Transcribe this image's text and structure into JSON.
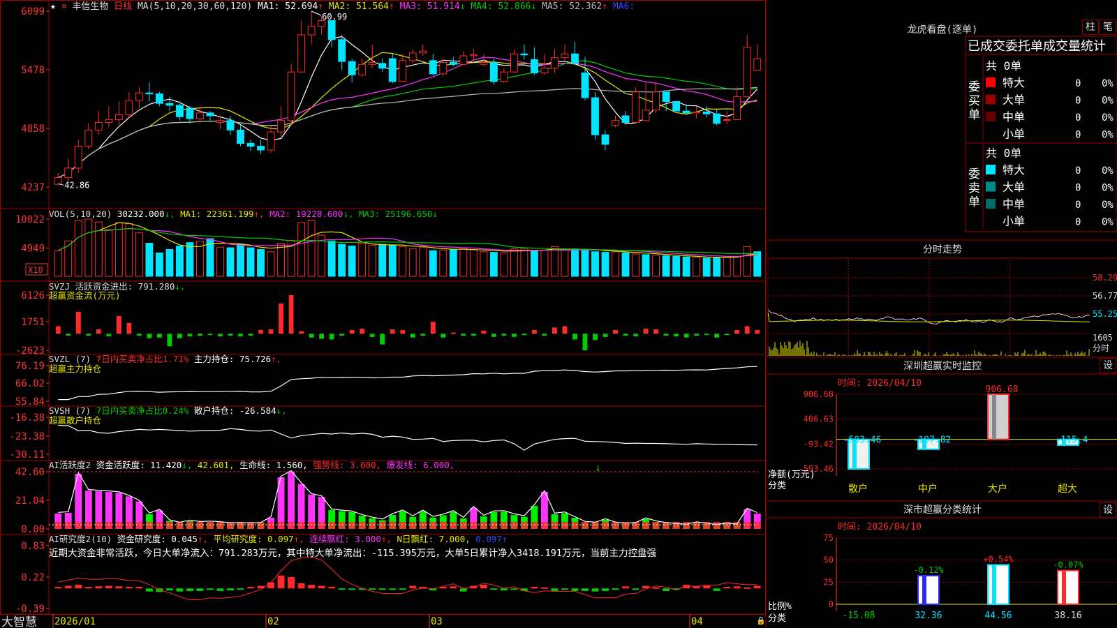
{
  "colors": {
    "up": "#ff2a2a",
    "down": "#00e4ff",
    "grid": "#a00000",
    "white": "#ffffff",
    "yellow": "#e6e600",
    "magenta": "#ff33ff",
    "green": "#00cc00",
    "gray": "#bbbbbb",
    "text": "#c8c8c8",
    "axis": "#ff3333"
  },
  "header": {
    "stock_name": "丰信生物",
    "period": "日线",
    "ma_title": "MA(5,10,20,30,60,120)",
    "ma_values": [
      {
        "label": "MA1: 52.694",
        "arrow": "↑",
        "color": "#ffffff"
      },
      {
        "label": "MA2: 51.564",
        "arrow": "↑",
        "color": "#e6e600"
      },
      {
        "label": "MA3: 51.914",
        "arrow": "↓",
        "color": "#ff33ff"
      },
      {
        "label": "MA4: 52.866",
        "arrow": "↓",
        "color": "#00cc00"
      },
      {
        "label": "MA5: 52.362",
        "arrow": "↑",
        "color": "#bbbbbb"
      },
      {
        "label": "MA6:",
        "arrow": "",
        "color": "#2a4dff"
      }
    ],
    "high_label": "60.99",
    "low_label": "42.86"
  },
  "price_axis": {
    "ticks": [
      "6099",
      "5478",
      "4858",
      "4237"
    ]
  },
  "volume": {
    "title": "VOL(5,10,20)",
    "value": "30232.000",
    "value_arrow": "↓",
    "ma1": "MA1: 22361.199",
    "ma1_arrow": "↑",
    "ma2": "MA2: 19228.600",
    "ma2_arrow": "↓",
    "ma3": "MA3: 25196.650",
    "ma3_arrow": "↓",
    "ticks": [
      "10022",
      "4949"
    ],
    "unit": "X10"
  },
  "svzj": {
    "title": "SVZJ  活跃资金进出: 791.280",
    "arrow": "↓",
    "subtitle": "超赢资金流(万元)",
    "ticks": [
      "6126",
      "1751",
      "-2623"
    ]
  },
  "svzl": {
    "title": "SVZL (7)",
    "red_text": "7日内买卖净占比1.71%",
    "white_text": "主力持仓: 75.726",
    "arrow": "↑",
    "subtitle": "超赢主力持仓",
    "ticks": [
      "76.19",
      "66.02",
      "55.84"
    ]
  },
  "svsh": {
    "title": "SVSH (7)",
    "green_text": "7日内买卖净占比0.24%",
    "white_text": "散户持仓: -26.584",
    "arrow": "↓",
    "subtitle": "超赢散户持仓",
    "ticks": [
      "-16.38",
      "-23.38",
      "-30.11"
    ]
  },
  "ai_active": {
    "title": "AI活跃度2",
    "l1": "资金活跃度: 11.420",
    "l1_arrow": "↓",
    "l2": "42.601",
    "l3": "生命线: 1.560",
    "l4": "强势线: 3.000",
    "l5": "爆发线: 6.000",
    "ticks": [
      "42.60",
      "21.04",
      "0.00"
    ]
  },
  "ai_research": {
    "title": "AI研究度2(10)",
    "l1": "资金研究度: 0.045",
    "l1_arrow": "↑",
    "l2": "平均研究度: 0.097",
    "l2_arrow": "↑",
    "l3": "连续飘红: 3.000",
    "l3_arrow": "↑",
    "l4": "N日飘红: 7.000",
    "l5": "0.097",
    "l5_arrow": "↑",
    "summary": "近期大资金非常活跃，今日大单净流入：791.283万元，其中特大单净流出：-115.395万元，大单5日累计净入3418.191万元，当前主力控盘强",
    "ticks": [
      "0.83",
      "0.22",
      "-0.39"
    ]
  },
  "date_axis": {
    "labels": [
      "2026/01",
      "02",
      "03",
      "04"
    ],
    "brand": "大智慧"
  },
  "dragon_tiger": {
    "title": "龙虎看盘(逐单)",
    "btn1": "柱",
    "btn2": "笔",
    "header": "已成交委托单成交量统计",
    "buy": {
      "side_label": "委买单",
      "total": "共 0单",
      "rows": [
        {
          "name": "特大",
          "count": "0",
          "pct": "0%",
          "color": "#ff0000"
        },
        {
          "name": "大单",
          "count": "0",
          "pct": "0%",
          "color": "#990000"
        },
        {
          "name": "中单",
          "count": "0",
          "pct": "0%",
          "color": "#660000"
        },
        {
          "name": "小单",
          "count": "0",
          "pct": "0%",
          "color": ""
        }
      ]
    },
    "sell": {
      "side_label": "委卖单",
      "total": "共 0单",
      "rows": [
        {
          "name": "特大",
          "count": "0",
          "pct": "0%",
          "color": "#00e4ff"
        },
        {
          "name": "大单",
          "count": "0",
          "pct": "0%",
          "color": "#008b8b"
        },
        {
          "name": "中单",
          "count": "0",
          "pct": "0%",
          "color": "#006b6b"
        },
        {
          "name": "小单",
          "count": "0",
          "pct": "0%",
          "color": ""
        }
      ]
    }
  },
  "intraday": {
    "title": "分时走势",
    "ticks": [
      "58.29",
      "56.77",
      "55.25",
      "1605"
    ],
    "unit": "分时"
  },
  "sz_monitor": {
    "title": "深圳超赢实时监控",
    "btn": "设",
    "time": "时间: 2026/04/10",
    "ylabel": "净额(万元)",
    "xlabel": "分类"
  },
  "sz_class": {
    "title": "深市超赢分类统计",
    "btn": "设",
    "time": "时间: 2026/04/10",
    "ylabel": "比例%",
    "xlabel": "分类"
  },
  "chart_data": [
    {
      "type": "candlestick",
      "name": "price",
      "open": [
        42.8,
        43.5,
        44.5,
        46.8,
        48.5,
        49.3,
        49.6,
        50.1,
        51.6,
        52.4,
        52.3,
        51.3,
        51.1,
        50.8,
        49.7,
        50.3,
        49.3,
        49.5,
        48.5,
        47.1,
        46.8,
        46.4,
        48.3,
        49.5,
        54.6,
        58.5,
        59.4,
        60,
        58,
        55.7,
        54.3,
        55.4,
        55.5,
        56,
        53.6,
        55.8,
        56.6,
        55.8,
        54.4,
        55.6,
        55.4,
        56.3,
        55.4,
        55.6,
        53.6,
        54.6,
        56.5,
        55.9,
        54.5,
        55,
        56.1,
        56.5,
        54.5,
        51.9,
        48,
        49,
        50,
        49.3,
        49.5,
        50.6,
        52.5,
        51.5,
        50.5,
        50.3,
        50.4,
        50.2,
        49.6,
        49.6,
        52,
        54.8
      ],
      "close": [
        43.5,
        44.5,
        46.8,
        48.5,
        49.3,
        49.6,
        50.1,
        51.6,
        52.4,
        52.3,
        51.3,
        51.1,
        49.9,
        49.7,
        50.3,
        50,
        49.5,
        48.5,
        47.1,
        46.8,
        46.4,
        48.3,
        49.5,
        54.6,
        58.5,
        59.4,
        60,
        58,
        55.7,
        54.3,
        55.4,
        55.6,
        55,
        53.6,
        55.8,
        56.6,
        56.8,
        54.4,
        55.6,
        55.4,
        56.3,
        56.4,
        55.6,
        53.6,
        54.6,
        56.5,
        56.4,
        54.5,
        55,
        56.1,
        56.5,
        55.5,
        51.9,
        48,
        47,
        49.5,
        49.3,
        52.5,
        50.6,
        52.5,
        51.5,
        50.5,
        50.3,
        50.4,
        50.2,
        49.2,
        49.6,
        52,
        57.2,
        56
      ],
      "high": [
        44,
        45.5,
        47.5,
        49.2,
        50.5,
        51,
        51.5,
        52.5,
        53,
        53.5,
        52.5,
        52,
        51.5,
        51,
        51,
        50.5,
        50,
        50,
        49,
        47.5,
        47.5,
        49,
        51,
        55.5,
        60,
        60.99,
        60.5,
        60,
        58.5,
        56,
        56,
        57.5,
        56,
        56.5,
        56.5,
        57,
        57.5,
        56.5,
        56,
        56.2,
        56.8,
        57,
        56.5,
        56,
        55,
        57,
        57.5,
        57.2,
        56.5,
        57,
        57.5,
        57.8,
        56.2,
        52.5,
        48.5,
        50,
        50.5,
        53,
        53.5,
        53.5,
        52,
        51,
        51.2,
        51,
        51,
        50.7,
        50.5,
        53,
        58.5,
        57.5
      ],
      "low": [
        42.86,
        43,
        44,
        46.5,
        48,
        48.8,
        49,
        49.8,
        50.8,
        51.5,
        51,
        50.5,
        49.5,
        49.2,
        49.2,
        49.5,
        48.6,
        48,
        46.8,
        46.3,
        46,
        46.1,
        47.8,
        49,
        54.5,
        57.5,
        58.5,
        57.2,
        54.8,
        53.5,
        54,
        55,
        54.6,
        53.4,
        53.6,
        55.5,
        56.3,
        54.2,
        54.2,
        55.2,
        55.3,
        55.8,
        55.2,
        53.3,
        53.5,
        54.5,
        55.9,
        54.3,
        54.3,
        54.5,
        55.8,
        55.4,
        51.6,
        47.5,
        46.4,
        48.8,
        49.2,
        49.3,
        50.5,
        50.3,
        50.5,
        50.5,
        50.2,
        49.7,
        49.8,
        49,
        49.1,
        51.8,
        52,
        55.5
      ],
      "ylim": [
        42.37,
        60.99
      ]
    },
    {
      "type": "bar",
      "name": "volume",
      "values": [
        4500,
        6200,
        9800,
        10022,
        9500,
        8200,
        9400,
        9200,
        7600,
        5800,
        4100,
        4700,
        5300,
        5900,
        6100,
        6600,
        5100,
        5000,
        5600,
        5000,
        4700,
        4300,
        5800,
        6300,
        9400,
        9800,
        7200,
        6200,
        5600,
        5300,
        5800,
        5400,
        5600,
        5400,
        5200,
        4800,
        5100,
        4500,
        4600,
        4700,
        4800,
        4700,
        4300,
        4200,
        4100,
        4800,
        4900,
        4500,
        4600,
        5200,
        4600,
        4800,
        4500,
        4300,
        4200,
        4300,
        4100,
        3900,
        3800,
        3700,
        3600,
        3500,
        3400,
        3300,
        3200,
        3300,
        3400,
        3500,
        5200,
        4300
      ],
      "up_down": [
        1,
        1,
        1,
        1,
        1,
        1,
        1,
        1,
        1,
        0,
        0,
        0,
        0,
        0,
        1,
        0,
        1,
        0,
        0,
        0,
        0,
        1,
        1,
        1,
        1,
        1,
        1,
        0,
        0,
        0,
        1,
        1,
        0,
        0,
        1,
        1,
        1,
        0,
        1,
        0,
        1,
        1,
        1,
        0,
        1,
        1,
        1,
        0,
        1,
        1,
        1,
        0,
        0,
        0,
        0,
        1,
        0,
        1,
        0,
        1,
        0,
        0,
        0,
        1,
        0,
        0,
        1,
        1,
        1,
        0
      ],
      "ylim": [
        0,
        10500
      ]
    },
    {
      "type": "bar",
      "name": "svzj",
      "values": [
        1200,
        -300,
        3500,
        -300,
        700,
        -400,
        2800,
        1700,
        -300,
        -700,
        -600,
        -2000,
        -700,
        -400,
        -300,
        -200,
        -400,
        -300,
        -400,
        -300,
        600,
        700,
        4800,
        6126,
        400,
        -600,
        -800,
        -900,
        -300,
        600,
        800,
        -500,
        -1700,
        700,
        600,
        -600,
        -300,
        1900,
        -600,
        200,
        -300,
        -300,
        500,
        -500,
        -300,
        -500,
        -200,
        600,
        -300,
        1000,
        1200,
        -900,
        -2623,
        -1000,
        -500,
        600,
        -300,
        -400,
        800,
        700,
        -300,
        -400,
        -600,
        -300,
        -200,
        -600,
        -200,
        600,
        1200,
        600
      ],
      "ylim": [
        -2623,
        6126
      ]
    },
    {
      "type": "line",
      "name": "svzl",
      "values": [
        56.8,
        56.8,
        58.5,
        58.5,
        59.8,
        59.9,
        60.8,
        61.5,
        61.6,
        61.3,
        61,
        61.2,
        61.3,
        61.4,
        61.3,
        61.3,
        61.3,
        61.5,
        61.6,
        61.2,
        61.2,
        61.5,
        64.6,
        68.3,
        68.7,
        69,
        69.5,
        69.3,
        69.4,
        69.5,
        69.5,
        69.2,
        69.3,
        69.6,
        69.6,
        70.3,
        70.6,
        70.4,
        70.6,
        70.8,
        71,
        71.6,
        71.5,
        71.9,
        71.5,
        71.8,
        71.8,
        73,
        73.3,
        73.4,
        73.7,
        73.4,
        72.8,
        72.5,
        72.8,
        73.2,
        73.2,
        73.3,
        73.5,
        73.5,
        73.6,
        73.5,
        73.7,
        73.8,
        73.7,
        74.2,
        74.6,
        74.9,
        75.5,
        75.7
      ],
      "ylim": [
        55.84,
        76.19
      ]
    },
    {
      "type": "line",
      "name": "svsh",
      "values": [
        -19.4,
        -19.5,
        -21.4,
        -21.2,
        -22.1,
        -22.3,
        -21.7,
        -21.3,
        -20.9,
        -21.1,
        -20.9,
        -21.1,
        -21.3,
        -21.5,
        -21.4,
        -21.3,
        -21.2,
        -20.6,
        -20.9,
        -21.4,
        -21.5,
        -21.1,
        -22.6,
        -24.1,
        -23.2,
        -22.8,
        -22.4,
        -22.6,
        -22.2,
        -22.6,
        -22.3,
        -22.7,
        -23.8,
        -23.4,
        -23.7,
        -24.6,
        -24.5,
        -24.2,
        -25.4,
        -25,
        -24.9,
        -24.9,
        -25.5,
        -25,
        -24.8,
        -26.2,
        -28.6,
        -26.3,
        -25.4,
        -24.6,
        -24.3,
        -24.2,
        -25.3,
        -25.4,
        -25.5,
        -25.7,
        -26.1,
        -26,
        -26.1,
        -26.1,
        -26.2,
        -26.3,
        -26.4,
        -26.2,
        -26.3,
        -26.4,
        -26.4,
        -26.5,
        -26.6,
        -26.6
      ],
      "ylim": [
        -30.11,
        -16.38
      ]
    },
    {
      "type": "bar",
      "name": "ai_active",
      "values": [
        11.5,
        12,
        41,
        28.5,
        28,
        27.5,
        26.8,
        24.2,
        20.5,
        11,
        13.8,
        6,
        4.2,
        5.8,
        4.7,
        5,
        4.6,
        3.7,
        3.8,
        3.6,
        4,
        8.3,
        38.5,
        42.6,
        33.5,
        25.5,
        23.8,
        14,
        13.2,
        12.5,
        9.8,
        8,
        6.5,
        10.5,
        13.3,
        9,
        13.2,
        8.5,
        10.2,
        12.8,
        7.8,
        15.8,
        9.3,
        12.6,
        12.8,
        10.5,
        9,
        17.2,
        27.6,
        11,
        11.8,
        8.3,
        4.8,
        4.2,
        6.8,
        4.3,
        3.5,
        3.9,
        7.4,
        5.2,
        3.9,
        3.3,
        2.7,
        4.4,
        3.5,
        2.5,
        3.6,
        2.8,
        14.6,
        11.4
      ],
      "magenta": [
        1,
        1,
        1,
        1,
        1,
        1,
        1,
        1,
        1,
        0,
        1,
        0,
        0,
        0,
        0,
        0,
        0,
        0,
        0,
        0,
        0,
        1,
        1,
        1,
        1,
        1,
        1,
        0,
        0,
        0,
        0,
        0,
        0,
        0,
        0,
        0,
        0,
        0,
        0,
        0,
        0,
        1,
        0,
        0,
        0,
        0,
        0,
        0,
        1,
        0,
        0,
        0,
        0,
        0,
        0,
        0,
        0,
        0,
        0,
        0,
        0,
        0,
        0,
        0,
        0,
        0,
        0,
        0,
        1,
        1
      ],
      "ylim": [
        0,
        42.6
      ]
    },
    {
      "type": "bar",
      "name": "ai_research",
      "values": [
        0.03,
        0.05,
        0.07,
        0.03,
        0.04,
        0.05,
        0.04,
        0.03,
        0.03,
        -0.06,
        -0.07,
        -0.04,
        -0.06,
        -0.05,
        -0.05,
        -0.03,
        -0.05,
        -0.04,
        -0.02,
        0.03,
        0.05,
        0.12,
        0.25,
        0.22,
        0.1,
        0.07,
        0.05,
        0.03,
        -0.02,
        -0.03,
        -0.03,
        -0.02,
        -0.02,
        -0.03,
        -0.02,
        0.05,
        0.03,
        -0.04,
        0.03,
        0.04,
        -0.06,
        0.05,
        0.07,
        -0.02,
        -0.04,
        -0.02,
        -0.05,
        0.03,
        0.02,
        -0.05,
        -0.02,
        -0.05,
        -0.05,
        -0.06,
        -0.05,
        -0.02,
        0.04,
        -0.03,
        0.05,
        0.02,
        -0.05,
        -0.03,
        0.07,
        0.04,
        0.05,
        -0.05,
        0.03,
        0.04,
        0.02,
        0.05
      ],
      "ylim": [
        -0.39,
        0.83
      ]
    },
    {
      "type": "bar",
      "name": "sz_monitor",
      "categories": [
        "散户",
        "中户",
        "大户",
        "超大"
      ],
      "values": [
        -593.46,
        -197.82,
        906.68,
        -115.4
      ],
      "ticks": [
        906.68,
        406.63,
        -93.42,
        -593.46
      ],
      "ylim": [
        -593.46,
        906.68
      ]
    },
    {
      "type": "bar",
      "name": "sz_class",
      "categories": [
        "散户",
        "中户",
        "大户",
        "超大"
      ],
      "values": [
        -15.08,
        32.36,
        44.56,
        38.16
      ],
      "changes": [
        "",
        "-0.12%",
        "+0.54%",
        "-0.07%"
      ],
      "ticks": [
        75,
        50,
        25,
        0
      ],
      "ylim": [
        0,
        75
      ]
    }
  ]
}
